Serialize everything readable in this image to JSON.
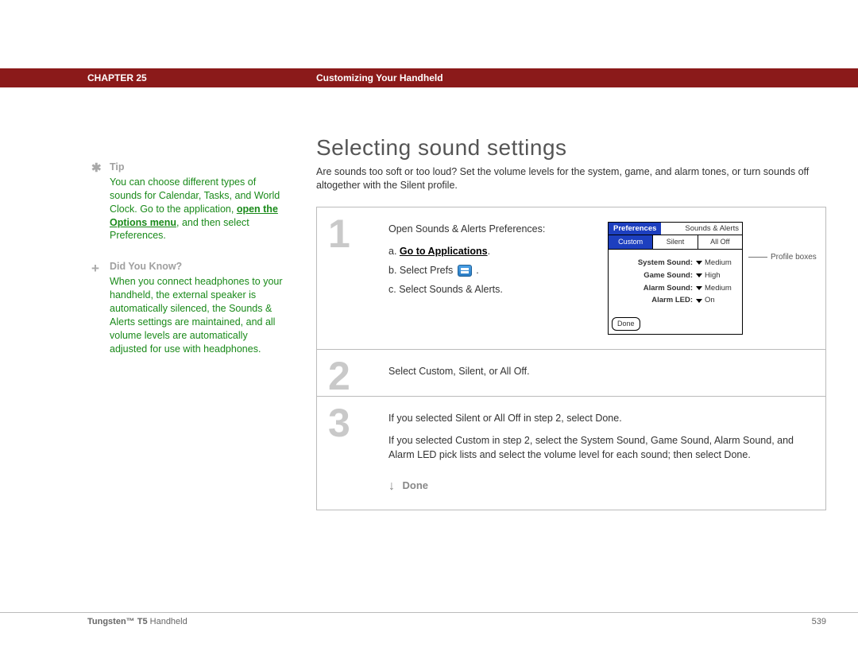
{
  "header": {
    "chapter": "CHAPTER 25",
    "title": "Customizing Your Handheld"
  },
  "page": {
    "title": "Selecting sound settings",
    "intro": "Are sounds too soft or too loud? Set the volume levels for the system, game, and alarm tones, or turn sounds off altogether with the Silent profile."
  },
  "sidebar": {
    "tip": {
      "label": "Tip",
      "pre": "You can choose different types of sounds for Calendar, Tasks, and World Clock. Go to the application, ",
      "link": "open the Options menu",
      "post": ", and then select Preferences."
    },
    "dyk": {
      "label": "Did You Know?",
      "text": "When you connect headphones to your handheld, the external speaker is automatically silenced, the Sounds & Alerts settings are maintained, and all volume levels are automatically adjusted for use with headphones."
    }
  },
  "steps": {
    "s1": {
      "num": "1",
      "lead": "Open Sounds & Alerts Preferences:",
      "a_prefix": "a.  ",
      "a_link": "Go to Applications",
      "a_suffix": ".",
      "b_prefix": "b.  Select Prefs ",
      "b_suffix": " .",
      "c": "c.  Select Sounds & Alerts."
    },
    "s2": {
      "num": "2",
      "text": "Select Custom, Silent, or All Off."
    },
    "s3": {
      "num": "3",
      "p1": "If you selected Silent or All Off in step 2, select Done.",
      "p2": "If you selected Custom in step 2, select the System Sound, Game Sound, Alarm Sound, and Alarm LED pick lists and select the volume level for each sound; then select Done.",
      "done": "Done"
    }
  },
  "mini": {
    "title_left": "Preferences",
    "title_right": "Sounds & Alerts",
    "tabs": [
      "Custom",
      "Silent",
      "All Off"
    ],
    "rows": [
      {
        "k": "System Sound:",
        "v": "Medium"
      },
      {
        "k": "Game Sound:",
        "v": "High"
      },
      {
        "k": "Alarm Sound:",
        "v": "Medium"
      },
      {
        "k": "Alarm LED:",
        "v": "On"
      }
    ],
    "done": "Done",
    "callout": "Profile boxes"
  },
  "footer": {
    "product_bold": "Tungsten™ T5",
    "product_rest": " Handheld",
    "page_number": "539"
  }
}
